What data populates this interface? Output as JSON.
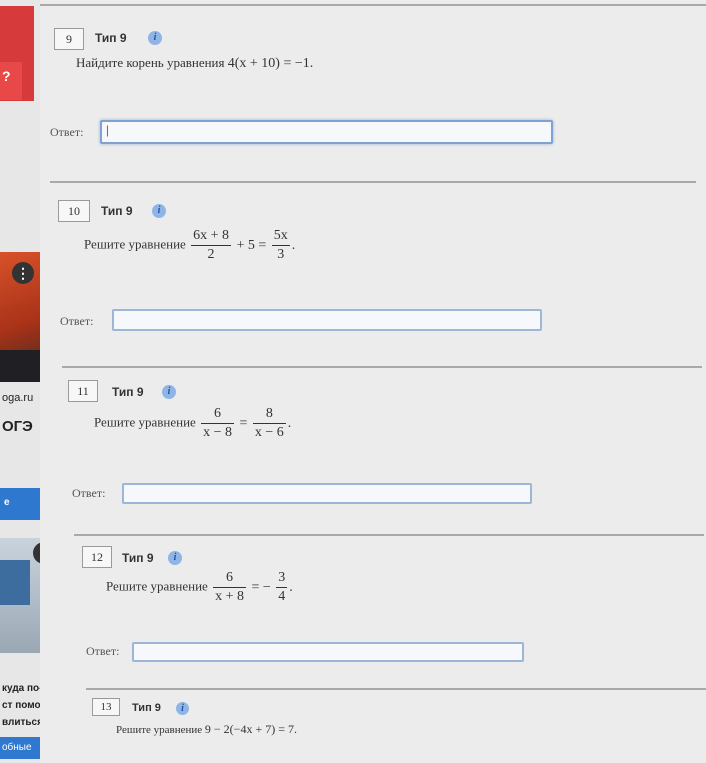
{
  "sidebar": {
    "site_text": "oga.ru",
    "exam_text": "ОГЭ",
    "blue_button": "е",
    "more_symbol": "⋮",
    "caption_lines": [
      "куда по-",
      "ст помо-",
      "влиться"
    ],
    "bottom_button": "обные"
  },
  "tasks": [
    {
      "number": "9",
      "type": "Тип 9",
      "info": "i",
      "prompt": "Найдите корень уравнения",
      "equation": "4(x + 10) = −1.",
      "answer_label": "Ответ:",
      "answer_value": "|"
    },
    {
      "number": "10",
      "type": "Тип 9",
      "info": "i",
      "prompt": "Решите уравнение",
      "frac1": {
        "num": "6x + 8",
        "den": "2"
      },
      "middle": "+ 5 =",
      "frac2": {
        "num": "5x",
        "den": "3"
      },
      "end": ".",
      "answer_label": "Ответ:",
      "answer_value": ""
    },
    {
      "number": "11",
      "type": "Тип 9",
      "info": "i",
      "prompt": "Решите уравнение",
      "frac1": {
        "num": "6",
        "den": "x − 8"
      },
      "middle": "=",
      "frac2": {
        "num": "8",
        "den": "x − 6"
      },
      "end": ".",
      "answer_label": "Ответ:",
      "answer_value": ""
    },
    {
      "number": "12",
      "type": "Тип 9",
      "info": "i",
      "prompt": "Решите уравнение",
      "frac1": {
        "num": "6",
        "den": "x + 8"
      },
      "middle": "= −",
      "frac2": {
        "num": "3",
        "den": "4"
      },
      "end": ".",
      "answer_label": "Ответ:",
      "answer_value": ""
    },
    {
      "number": "13",
      "type": "Тип 9",
      "info": "i",
      "prompt": "Решите уравнение",
      "equation": "9 − 2(−4x + 7) = 7."
    }
  ]
}
